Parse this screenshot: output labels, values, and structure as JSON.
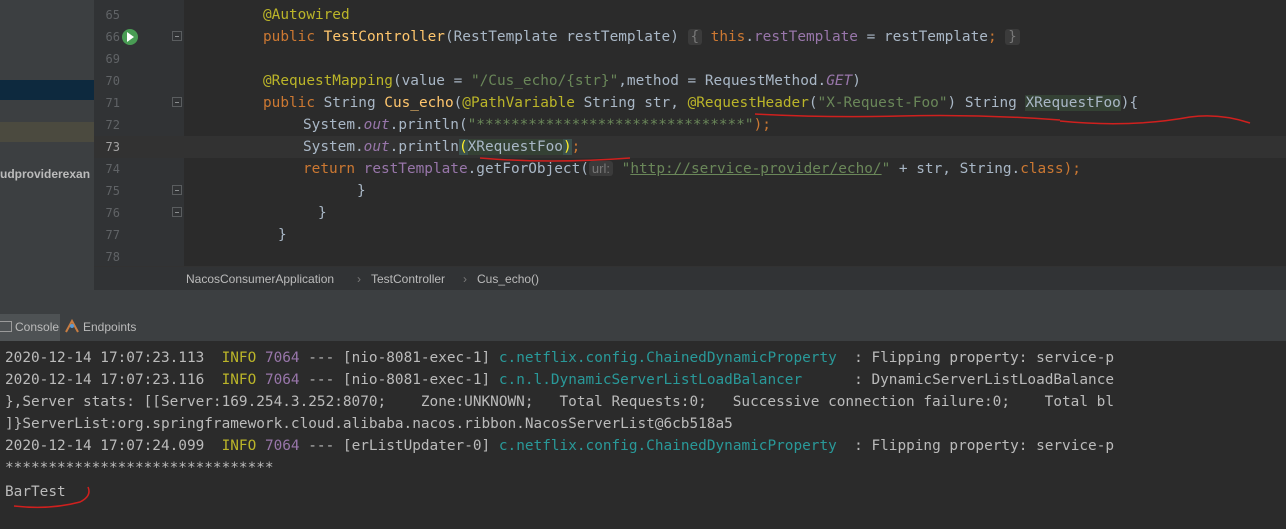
{
  "sidebar": {
    "project_label": "udproviderexan"
  },
  "editor": {
    "line_numbers": [
      "65",
      "66",
      "69",
      "70",
      "71",
      "72",
      "73",
      "74",
      "75",
      "76",
      "77",
      "78"
    ],
    "l65": {
      "annotation": "@Autowired"
    },
    "l66": {
      "kw_public": "public",
      "ctor_name": "TestController",
      "params": "(RestTemplate restTemplate)",
      "brace_open": "{",
      "this_kw": "this",
      "dot": ".",
      "field": "restTemplate",
      "assign": " = restTemplate",
      "semi": ";",
      "brace_close": "}"
    },
    "l70": {
      "annotation": "@RequestMapping",
      "args_open": "(value = ",
      "path": "\"/Cus_echo/{str}\"",
      "comma_method": ",method = RequestMethod.",
      "get": "GET",
      "close": ")"
    },
    "l71": {
      "kw_public": "public",
      "ret_type": " String ",
      "method_name": "Cus_echo",
      "open": "(",
      "pathvar": "@PathVariable",
      "p1": " String str, ",
      "reqheader": "@RequestHeader",
      "p2_open": "(",
      "header_name": "\"X-Request-Foo\"",
      "p2_close": ") String ",
      "param_name": "XRequestFoo",
      "end": "){"
    },
    "l72": {
      "prefix": "System.",
      "out": "out",
      "println": ".println(",
      "stars": "\"*******************************\"",
      "end": ");"
    },
    "l73": {
      "prefix": "System.",
      "out": "out",
      "println": ".println",
      "open": "(",
      "arg": "XRequestFoo",
      "close": ")",
      "semi": ";"
    },
    "l74": {
      "kw_return": "return",
      "field": "restTemplate",
      "call": ".getForObject(",
      "hint": "url:",
      "url": "http://service-provider/echo/",
      "q1": "\"",
      "q2": "\"",
      "rest": " + str, String.",
      "class_kw": "class",
      "end": ");"
    },
    "l75": {
      "brace": "}"
    },
    "l76": {
      "brace": "}"
    },
    "l77": {
      "brace": "}"
    }
  },
  "breadcrumb": {
    "items": [
      "NacosConsumerApplication",
      "TestController",
      "Cus_echo()"
    ],
    "separator": "›"
  },
  "tool_tabs": {
    "console": "Console",
    "endpoints": "Endpoints"
  },
  "console": {
    "lines": [
      {
        "ts": "2020-12-14 17:07:23.113",
        "level": "INFO",
        "pid": "7064",
        "dash": " --- ",
        "thread": "[nio-8081-exec-1]",
        "logger": "c.netflix.config.ChainedDynamicProperty",
        "msg": "  : Flipping property: service-p"
      },
      {
        "ts": "2020-12-14 17:07:23.116",
        "level": "INFO",
        "pid": "7064",
        "dash": " --- ",
        "thread": "[nio-8081-exec-1]",
        "logger": "c.n.l.DynamicServerListLoadBalancer",
        "msg": "      : DynamicServerListLoadBalance"
      },
      {
        "text": "},Server stats: [[Server:169.254.3.252:8070;    Zone:UNKNOWN;   Total Requests:0;   Successive connection failure:0;    Total bl"
      },
      {
        "text": "]}ServerList:org.springframework.cloud.alibaba.nacos.ribbon.NacosServerList@6cb518a5"
      },
      {
        "ts": "2020-12-14 17:07:24.099",
        "level": "INFO",
        "pid": "7064",
        "dash": " --- ",
        "thread": "[erListUpdater-0]",
        "logger": "c.netflix.config.ChainedDynamicProperty",
        "msg": "  : Flipping property: service-p"
      },
      {
        "text": "*******************************"
      },
      {
        "text": "BarTest"
      }
    ]
  },
  "colors": {
    "editor_bg": "#2b2b2b",
    "keyword": "#cc7832",
    "annotation": "#bbb529",
    "string": "#6a8759",
    "annotation_underline": "#d0201e"
  }
}
